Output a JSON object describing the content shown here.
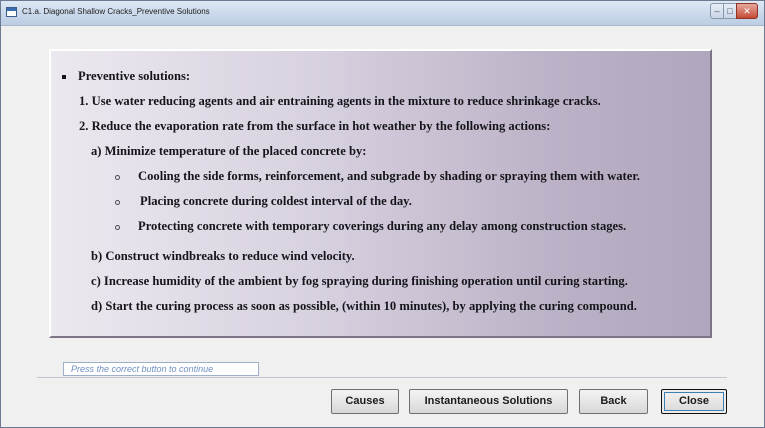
{
  "window": {
    "title": "C1.a. Diagonal Shallow Cracks_Preventive Solutions",
    "icon": "app-window-icon",
    "caption_buttons": {
      "minimize": "–",
      "maximize": "□",
      "close": "✕"
    }
  },
  "content": {
    "heading": "Preventive solutions:",
    "item1": "1. Use water reducing agents and air entraining agents in the mixture to reduce shrinkage cracks.",
    "item2": "2. Reduce the evaporation rate from the surface in hot weather by the following actions:",
    "sub_a": "a) Minimize temperature of the placed concrete by:",
    "sub_a_points": [
      "Cooling the side forms, reinforcement, and subgrade by shading or spraying them with water.",
      "Placing concrete during coldest interval of the day.",
      "Protecting concrete with temporary coverings during any delay among construction stages."
    ],
    "sub_b": "b) Construct windbreaks to reduce wind velocity.",
    "sub_c": "c) Increase humidity of the ambient by fog spraying during finishing operation until curing starting.",
    "sub_d": "d) Start the curing process as soon as possible, (within 10 minutes), by applying the curing compound."
  },
  "status_hint": "Press the correct button to continue",
  "buttons": {
    "causes": "Causes",
    "instantaneous": "Instantaneous Solutions",
    "back": "Back",
    "close": "Close"
  },
  "colors": {
    "panel_light": "#ece8ef",
    "panel_dark": "#b0a6bd",
    "hint_text": "#6f8fc4"
  }
}
